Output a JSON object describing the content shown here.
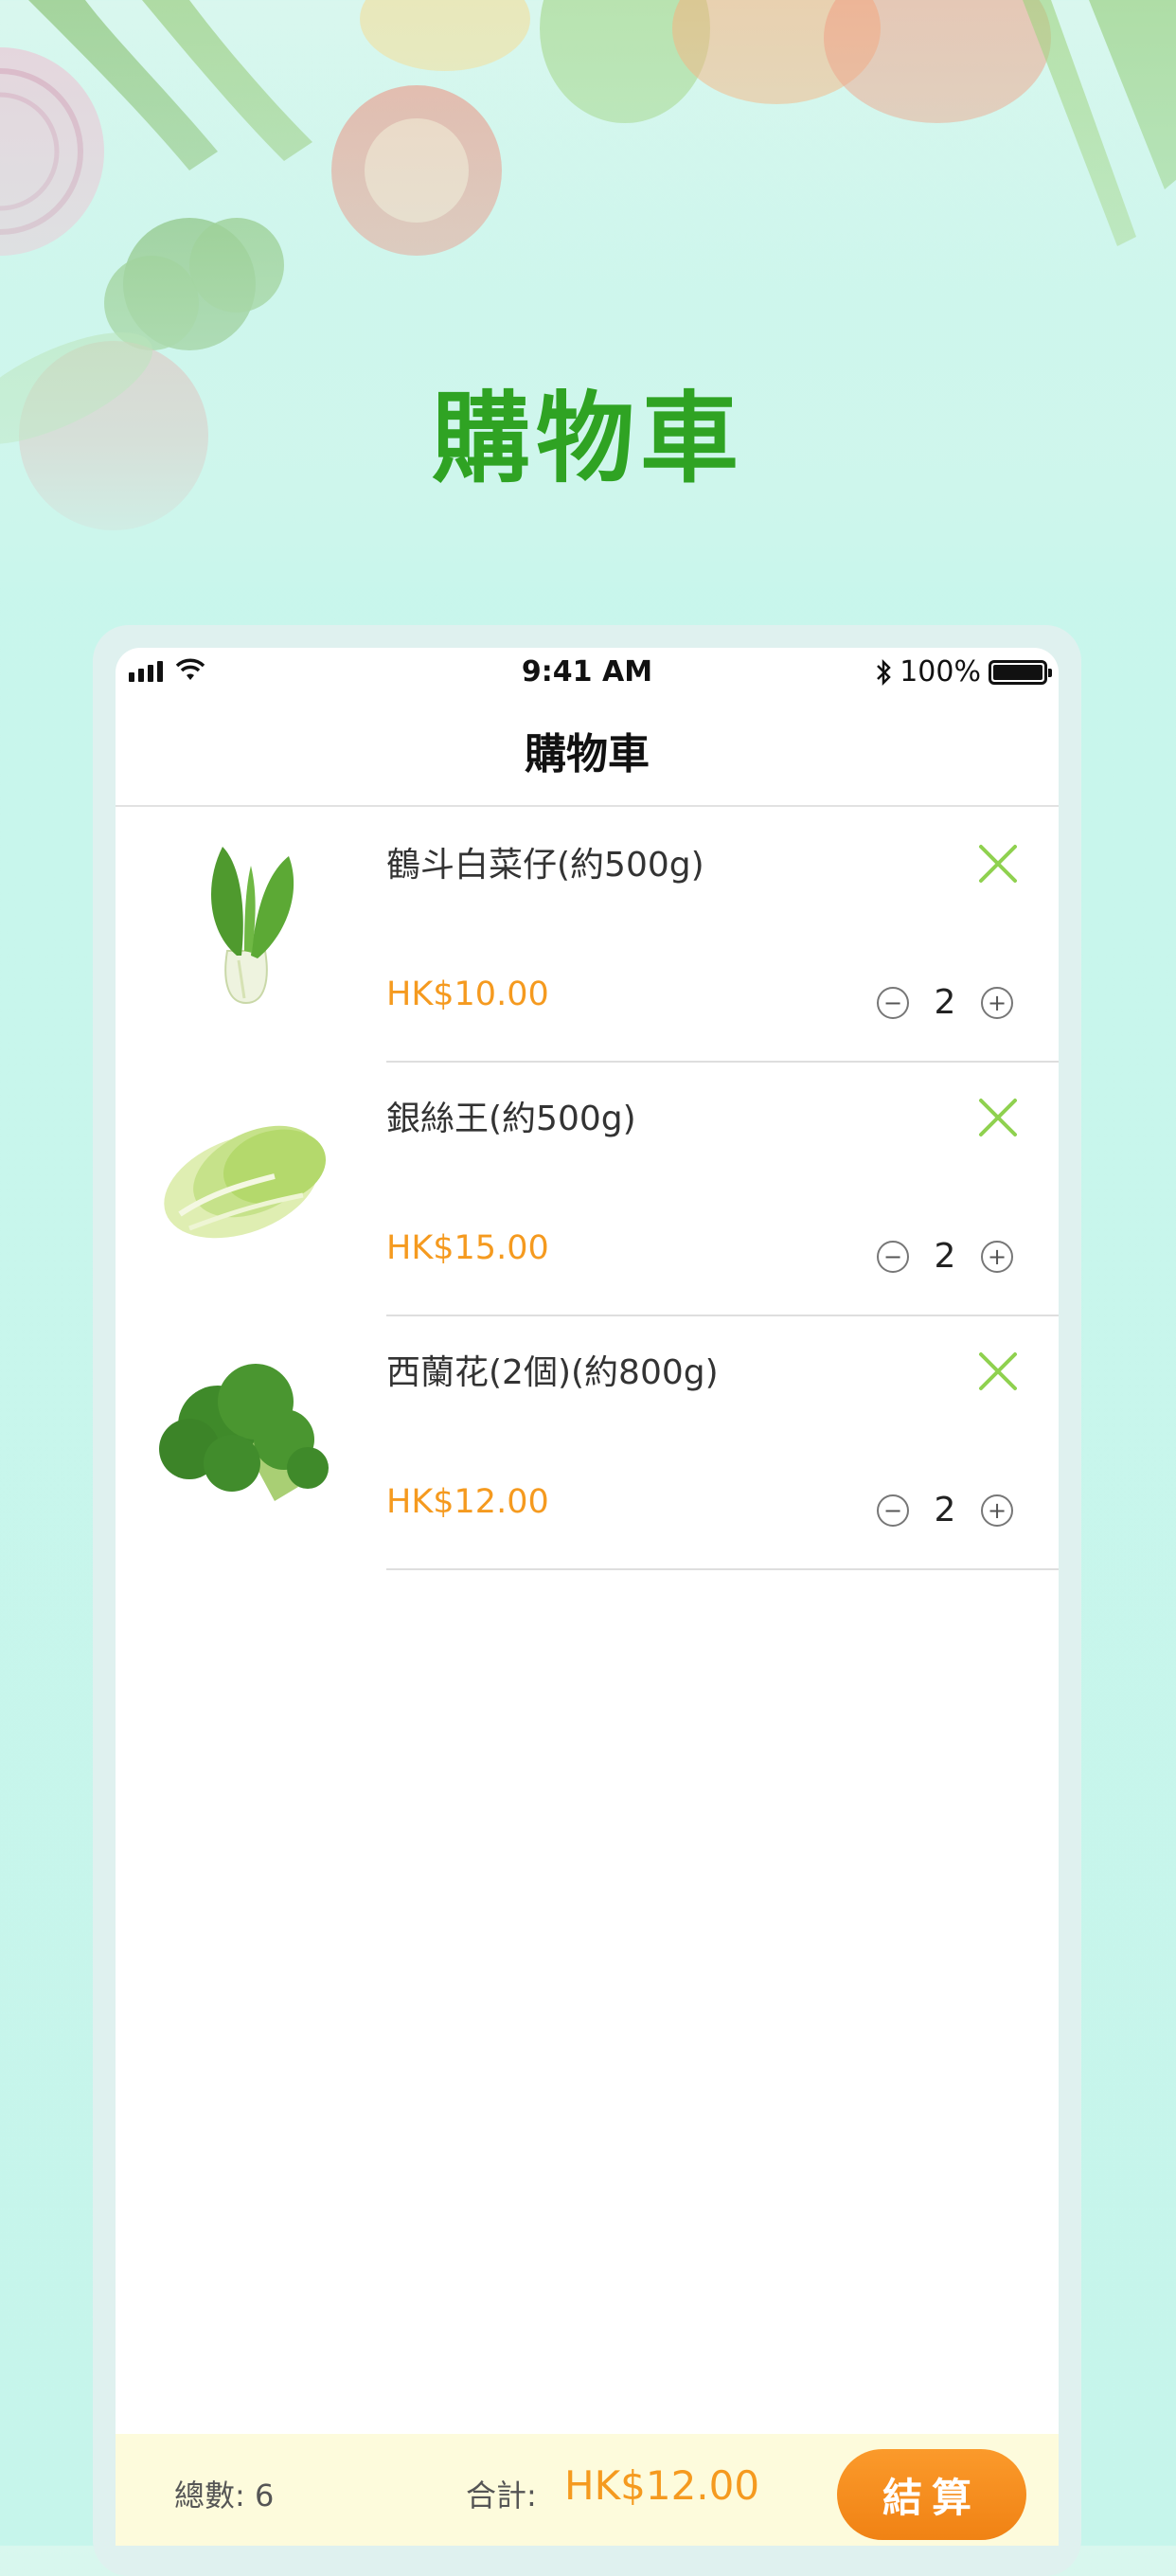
{
  "promo": {
    "title": "購物車"
  },
  "status_bar": {
    "time": "9:41 AM",
    "battery": "100%"
  },
  "nav": {
    "title": "購物車"
  },
  "cart": {
    "items": [
      {
        "name": "鶴斗白菜仔(約500g)",
        "price": "HK$10.00",
        "quantity": "2",
        "image": "bok-choy"
      },
      {
        "name": "銀絲王(約500g)",
        "price": "HK$15.00",
        "quantity": "2",
        "image": "napa-cabbage"
      },
      {
        "name": "西蘭花(2個)(約800g)",
        "price": "HK$12.00",
        "quantity": "2",
        "image": "broccoli"
      }
    ]
  },
  "checkout": {
    "count_label": "總數: 6",
    "sum_label": "合計:",
    "sum_value": "HK$12.00",
    "button_label": "結算"
  },
  "colors": {
    "title_green": "#2fa323",
    "price_orange": "#f59a1f",
    "remove_green": "#8fd14f",
    "checkout_orange": "#f5901d"
  }
}
